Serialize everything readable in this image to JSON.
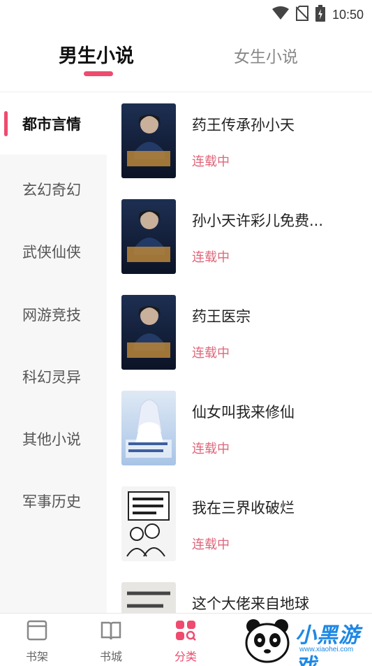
{
  "status_bar": {
    "time": "10:50",
    "icons": [
      "wifi-icon",
      "no-sim-icon",
      "battery-charging-icon"
    ]
  },
  "top_tabs": [
    {
      "label": "男生小说",
      "active": true
    },
    {
      "label": "女生小说",
      "active": false
    }
  ],
  "sidebar": {
    "items": [
      {
        "label": "都市言情",
        "active": true
      },
      {
        "label": "玄幻奇幻",
        "active": false
      },
      {
        "label": "武侠仙侠",
        "active": false
      },
      {
        "label": "网游竞技",
        "active": false
      },
      {
        "label": "科幻灵异",
        "active": false
      },
      {
        "label": "其他小说",
        "active": false
      },
      {
        "label": "军事历史",
        "active": false
      }
    ]
  },
  "books": [
    {
      "title": "药王传承孙小天",
      "status": "连载中",
      "cover": "yaowang-cover",
      "cover_text": "药王医宗"
    },
    {
      "title": "孙小天许彩儿免费...",
      "status": "连载中",
      "cover": "yaowang-cover",
      "cover_text": "药王医宗"
    },
    {
      "title": "药王医宗",
      "status": "连载中",
      "cover": "yaowang-cover",
      "cover_text": "药王医宗"
    },
    {
      "title": "仙女叫我来修仙",
      "status": "连载中",
      "cover": "fairy-cover",
      "cover_text": "仙女叫我来修仙"
    },
    {
      "title": "我在三界收破烂",
      "status": "连载中",
      "cover": "comic-cover",
      "cover_text": "我在三界收破烂"
    },
    {
      "title": "这个大佬来自地球",
      "status": "",
      "cover": "ink-cover",
      "cover_text": "这个大佬来自地球"
    }
  ],
  "bottom_nav": [
    {
      "label": "书架",
      "icon": "bookshelf-icon",
      "active": false
    },
    {
      "label": "书城",
      "icon": "open-book-icon",
      "active": false
    },
    {
      "label": "分类",
      "icon": "category-grid-icon",
      "active": true
    }
  ],
  "watermark": {
    "text": "小黑游戏",
    "url": "www.xiaohei.com"
  },
  "colors": {
    "accent": "#ee4b6e",
    "status": "#e0667a",
    "sidebar_bg": "#f7f7f7"
  }
}
